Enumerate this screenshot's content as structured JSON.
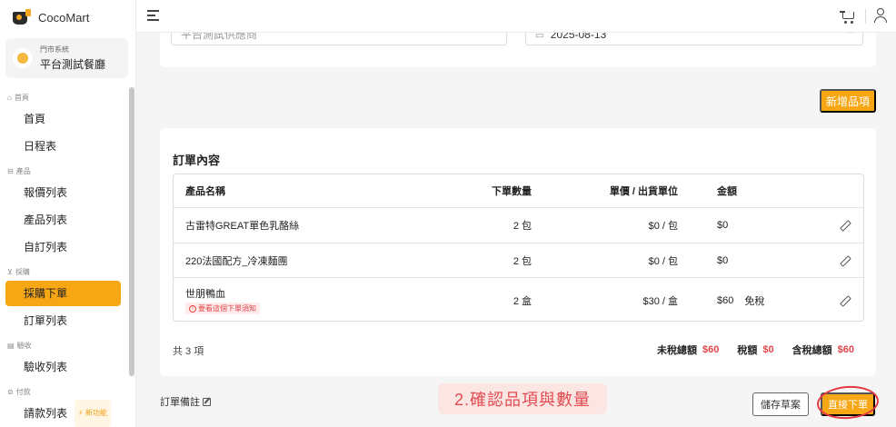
{
  "brand": {
    "name": "CocoMart"
  },
  "store": {
    "system_label": "門市系統",
    "name": "平台測試餐廳"
  },
  "nav": {
    "groups": [
      {
        "label": "首頁",
        "icon": "home-icon",
        "items": [
          {
            "label": "首頁"
          },
          {
            "label": "日程表"
          }
        ]
      },
      {
        "label": "產品",
        "icon": "box-icon",
        "items": [
          {
            "label": "報價列表"
          },
          {
            "label": "產品列表"
          },
          {
            "label": "自訂列表"
          }
        ]
      },
      {
        "label": "採購",
        "icon": "cart-icon",
        "items": [
          {
            "label": "採購下單",
            "active": true
          },
          {
            "label": "訂單列表"
          }
        ]
      },
      {
        "label": "驗收",
        "icon": "clipboard-icon",
        "items": [
          {
            "label": "驗收列表"
          }
        ]
      },
      {
        "label": "付款",
        "icon": "coin-icon",
        "items": [
          {
            "label": "請款列表",
            "badge": "⚡ 新功能"
          }
        ]
      }
    ]
  },
  "form": {
    "supplier_value": "平台測試供應商",
    "date_value": "2025-08-13",
    "clear_icon": "×"
  },
  "add_item_label": "新增品項",
  "order": {
    "title": "訂單內容",
    "headers": {
      "name": "產品名稱",
      "qty": "下單數量",
      "price": "單價 / 出貨單位",
      "amount": "金額"
    },
    "rows": [
      {
        "name": "古雷特GREAT單色乳酪絲",
        "qty": "2 包",
        "price": "$0 / 包",
        "amount": "$0",
        "note": "",
        "tax": ""
      },
      {
        "name": "220法國配方_冷凍麵團",
        "qty": "2 包",
        "price": "$0 / 包",
        "amount": "$0",
        "note": "",
        "tax": ""
      },
      {
        "name": "世朋鴨血",
        "qty": "2 盒",
        "price": "$30 / 盒",
        "amount": "$60",
        "note": "要看這個下單須知",
        "tax": "免稅"
      }
    ],
    "count_label": "共 3 項",
    "totals": {
      "pre_tax_label": "未稅總額",
      "pre_tax": "$60",
      "tax_label": "稅額",
      "tax": "$0",
      "total_label": "含稅總額",
      "total": "$60"
    }
  },
  "remark_label": "訂單備註",
  "annotation_text": "2.確認品項與數量",
  "buttons": {
    "save_draft": "儲存草案",
    "submit": "直接下單"
  },
  "colors": {
    "accent": "#f8a714",
    "danger": "#e2454a"
  }
}
